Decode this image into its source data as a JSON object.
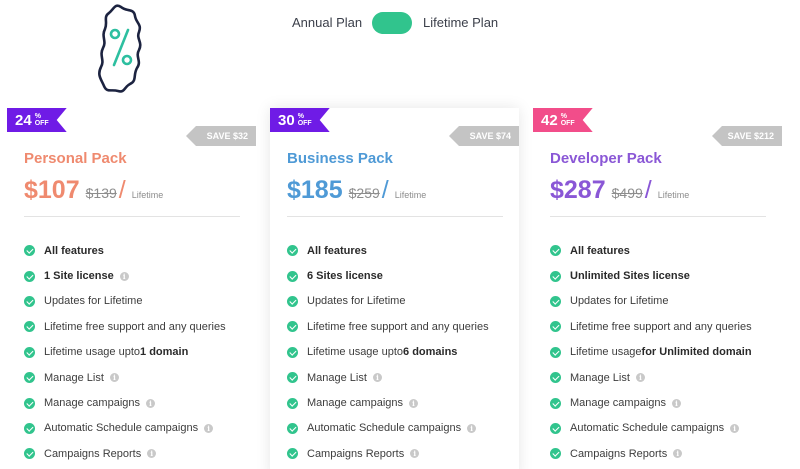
{
  "toggle": {
    "annual_label": "Annual Plan",
    "lifetime_label": "Lifetime Plan",
    "state": "lifetime",
    "color": "#31c48d"
  },
  "colors": {
    "check": "#31c48d",
    "save_tag": "#c4c4c4"
  },
  "icons": {
    "logo": "percent-badge-icon",
    "check": "check-circle-icon",
    "info": "info-icon"
  },
  "plans": [
    {
      "discount": {
        "value": "24",
        "percent": "%",
        "off": "OFF",
        "color": "#6f1be6"
      },
      "save": "SAVE $32",
      "name": "Personal Pack",
      "price": "$107",
      "old_price": "$139",
      "slash": "/",
      "period": "Lifetime",
      "accent": "#ef8a6f",
      "features": [
        {
          "text": "All features",
          "bold_all": true,
          "info": false
        },
        {
          "text": "1 Site license",
          "bold_all": true,
          "info": true
        },
        {
          "text": "Updates for Lifetime",
          "info": false
        },
        {
          "text": "Lifetime free support and any queries",
          "info": false
        },
        {
          "text": "Lifetime usage upto ",
          "strong": "1 domain",
          "info": false
        },
        {
          "text": "Manage List",
          "info": true
        },
        {
          "text": "Manage campaigns",
          "info": true
        },
        {
          "text": "Automatic Schedule campaigns",
          "info": true
        },
        {
          "text": "Campaigns Reports",
          "info": true
        }
      ]
    },
    {
      "discount": {
        "value": "30",
        "percent": "%",
        "off": "OFF",
        "color": "#6f1be6"
      },
      "save": "SAVE $74",
      "name": "Business Pack",
      "price": "$185",
      "old_price": "$259",
      "slash": "/",
      "period": "Lifetime",
      "accent": "#4f9ad6",
      "features": [
        {
          "text": "All features",
          "bold_all": true,
          "info": false
        },
        {
          "text": "6 Sites license",
          "bold_all": true,
          "info": false
        },
        {
          "text": "Updates for Lifetime",
          "info": false
        },
        {
          "text": "Lifetime free support and any queries",
          "info": false
        },
        {
          "text": "Lifetime usage upto ",
          "strong": "6 domains",
          "info": false
        },
        {
          "text": "Manage List",
          "info": true
        },
        {
          "text": "Manage campaigns",
          "info": true
        },
        {
          "text": "Automatic Schedule campaigns",
          "info": true
        },
        {
          "text": "Campaigns Reports",
          "info": true
        }
      ]
    },
    {
      "discount": {
        "value": "42",
        "percent": "%",
        "off": "OFF",
        "color": "#f24d8a"
      },
      "save": "SAVE $212",
      "name": "Developer Pack",
      "price": "$287",
      "old_price": "$499",
      "slash": "/",
      "period": "Lifetime",
      "accent": "#8a57d6",
      "features": [
        {
          "text": "All features",
          "bold_all": true,
          "info": false
        },
        {
          "text": "Unlimited Sites license",
          "bold_all": true,
          "info": false
        },
        {
          "text": "Updates for Lifetime",
          "info": false
        },
        {
          "text": "Lifetime free support and any queries",
          "info": false
        },
        {
          "text": "Lifetime usage ",
          "strong": "for Unlimited domain",
          "info": false
        },
        {
          "text": "Manage List",
          "info": true
        },
        {
          "text": "Manage campaigns",
          "info": true
        },
        {
          "text": "Automatic Schedule campaigns",
          "info": true
        },
        {
          "text": "Campaigns Reports",
          "info": true
        }
      ]
    }
  ]
}
